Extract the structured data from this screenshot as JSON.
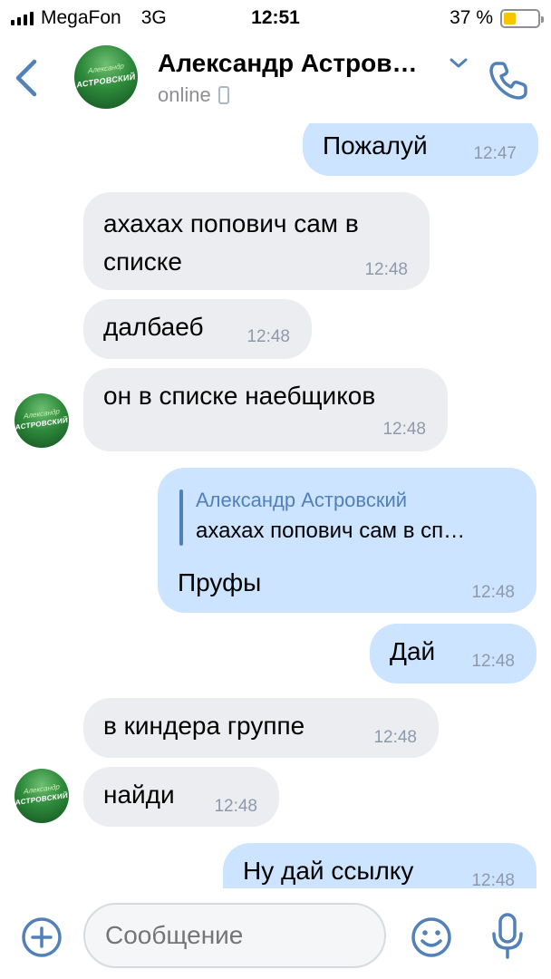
{
  "status_bar": {
    "carrier": "MegaFon",
    "network": "3G",
    "time": "12:51",
    "battery": "37 %",
    "battery_level": 0.37
  },
  "header": {
    "contact_name": "Александр Астров…",
    "status": "online",
    "avatar_top": "Александр",
    "avatar_text": "АСТРОВСКИЙ"
  },
  "messages": [
    {
      "direction": "out",
      "text": "Пожалуй",
      "time": "12:47"
    },
    {
      "direction": "in",
      "text": "ахахах попович сам в списке",
      "time": "12:48"
    },
    {
      "direction": "in",
      "text": "далбаеб",
      "time": "12:48"
    },
    {
      "direction": "in",
      "text": "он в списке наебщиков",
      "time": "12:48"
    },
    {
      "direction": "out",
      "quote_author": "Александр Астровский",
      "quote_text": "ахахах попович сам в сп…",
      "text": "Пруфы",
      "time": "12:48"
    },
    {
      "direction": "out",
      "text": "Дай",
      "time": "12:48"
    },
    {
      "direction": "in",
      "text": "в киндера группе",
      "time": "12:48"
    },
    {
      "direction": "in",
      "text": "найди",
      "time": "12:48"
    },
    {
      "direction": "out",
      "text": "Ну дай ссылку",
      "time": "12:48"
    }
  ],
  "input": {
    "placeholder": "Сообщение"
  },
  "colors": {
    "accent": "#5181b8",
    "incoming_bubble": "#ebedf0",
    "outgoing_bubble": "#cce4ff",
    "battery": "#f7c400"
  },
  "icons": [
    "back-icon",
    "chevron-down-icon",
    "phone-icon",
    "add-icon",
    "emoji-icon",
    "microphone-icon"
  ]
}
